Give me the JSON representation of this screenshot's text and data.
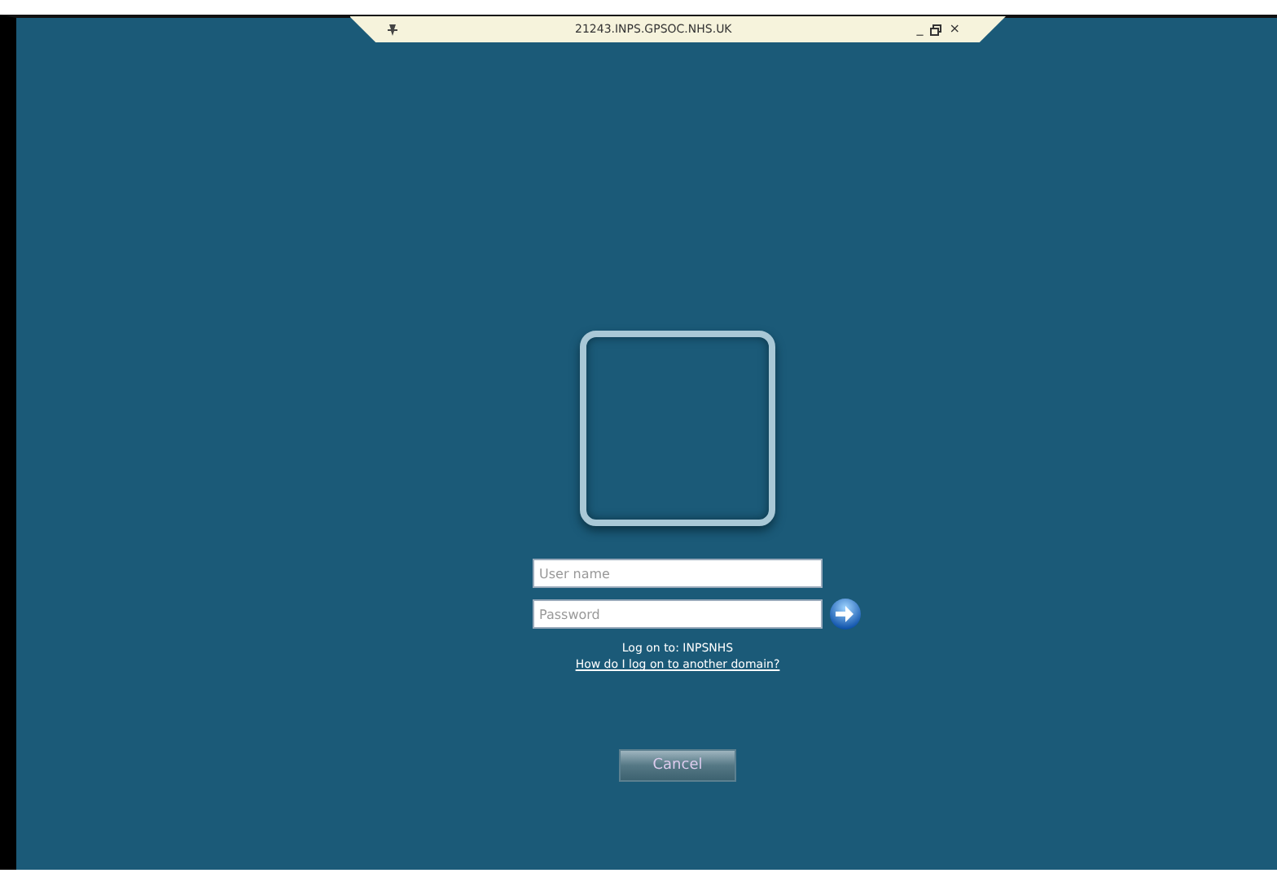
{
  "connection_bar": {
    "title": "21243.INPS.GPSOC.NHS.UK",
    "minimize": "_",
    "close": "×"
  },
  "logon": {
    "username": {
      "placeholder": "User name"
    },
    "password": {
      "placeholder": "Password"
    },
    "log_on_to": "Log on to: INPSNHS",
    "domain_link": "How do I log on to another domain?"
  },
  "buttons": [
    {
      "label": "Cancel"
    }
  ]
}
